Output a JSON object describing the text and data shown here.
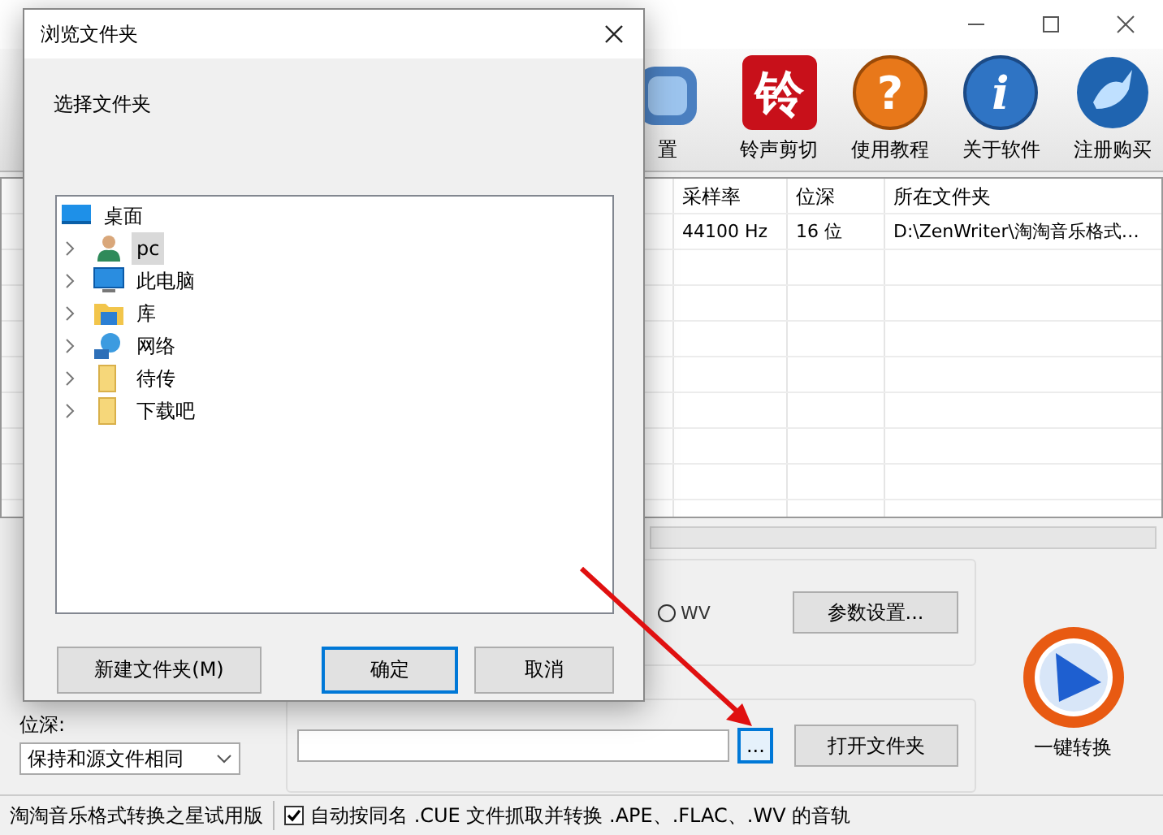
{
  "toolbar": [
    {
      "kind": "settings",
      "label": "置"
    },
    {
      "kind": "ringtone",
      "label": "铃声剪切",
      "glyph": "铃"
    },
    {
      "kind": "help",
      "label": "使用教程",
      "glyph": "?"
    },
    {
      "kind": "info",
      "label": "关于软件",
      "glyph": "i"
    },
    {
      "kind": "register",
      "label": "注册购买"
    }
  ],
  "file_table": {
    "columns": [
      "采样率",
      "位深",
      "所在文件夹"
    ],
    "rows": [
      [
        "44100 Hz",
        "16 位",
        "D:\\ZenWriter\\淘淘音乐格式…"
      ]
    ]
  },
  "format_options": [
    {
      "label": "WV",
      "selected": false
    }
  ],
  "params_button": "参数设置...",
  "browse_button": "...",
  "open_folder_button": "打开文件夹",
  "convert_button": "一键转换",
  "bit_depth": {
    "label": "位深:",
    "value": "保持和源文件相同"
  },
  "status_bar": {
    "app_name": "淘淘音乐格式转换之星试用版",
    "cue_option": {
      "label": "自动按同名 .CUE 文件抓取并转换 .APE、.FLAC、.WV 的音轨",
      "checked": true
    }
  },
  "dialog": {
    "title": "浏览文件夹",
    "prompt": "选择文件夹",
    "tree": [
      {
        "label": "桌面",
        "kind": "desktop",
        "selected": false,
        "children": [
          {
            "label": "pc",
            "kind": "user",
            "selected": true,
            "expanded": false
          },
          {
            "label": "此电脑",
            "kind": "computer",
            "selected": false,
            "expanded": false
          },
          {
            "label": "库",
            "kind": "library",
            "selected": false,
            "expanded": false
          },
          {
            "label": "网络",
            "kind": "network",
            "selected": false,
            "expanded": false
          },
          {
            "label": "待传",
            "kind": "folder",
            "selected": false,
            "expanded": false
          },
          {
            "label": "下载吧",
            "kind": "folder",
            "selected": false,
            "expanded": false
          }
        ]
      }
    ],
    "buttons": [
      {
        "label": "新建文件夹(M)",
        "default": false
      },
      {
        "label": "确定",
        "default": true
      },
      {
        "label": "取消",
        "default": false
      }
    ]
  }
}
